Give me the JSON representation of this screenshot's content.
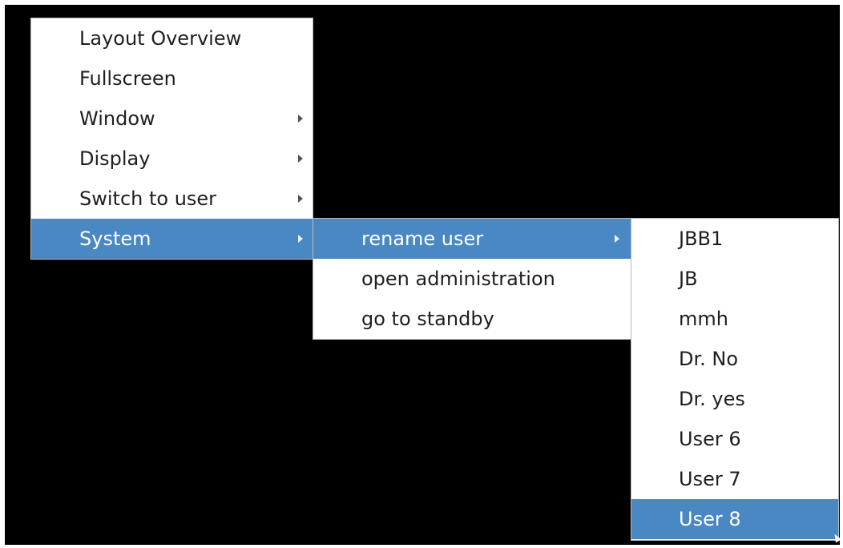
{
  "main_menu": {
    "items": [
      {
        "label": "Layout Overview",
        "submenu": false
      },
      {
        "label": "Fullscreen",
        "submenu": false
      },
      {
        "label": "Window",
        "submenu": true
      },
      {
        "label": "Display",
        "submenu": true
      },
      {
        "label": "Switch to user",
        "submenu": true
      },
      {
        "label": "System",
        "submenu": true,
        "highlighted": true
      }
    ]
  },
  "system_menu": {
    "items": [
      {
        "label": "rename user",
        "submenu": true,
        "highlighted": true
      },
      {
        "label": "open administration",
        "submenu": false
      },
      {
        "label": "go to standby",
        "submenu": false
      }
    ]
  },
  "users_menu": {
    "items": [
      {
        "label": "JBB1"
      },
      {
        "label": "JB"
      },
      {
        "label": "mmh"
      },
      {
        "label": "Dr. No"
      },
      {
        "label": "Dr. yes"
      },
      {
        "label": "User 6"
      },
      {
        "label": "User 7"
      },
      {
        "label": "User 8",
        "highlighted": true
      }
    ]
  },
  "colors": {
    "background": "#000000",
    "menu_background": "#ffffff",
    "highlight": "#4a88c4",
    "text": "#1e1e1e",
    "highlight_text": "#ffffff"
  },
  "icons": {
    "submenu_arrow": "chevron-right-icon",
    "pointer": "mouse-cursor-icon"
  }
}
